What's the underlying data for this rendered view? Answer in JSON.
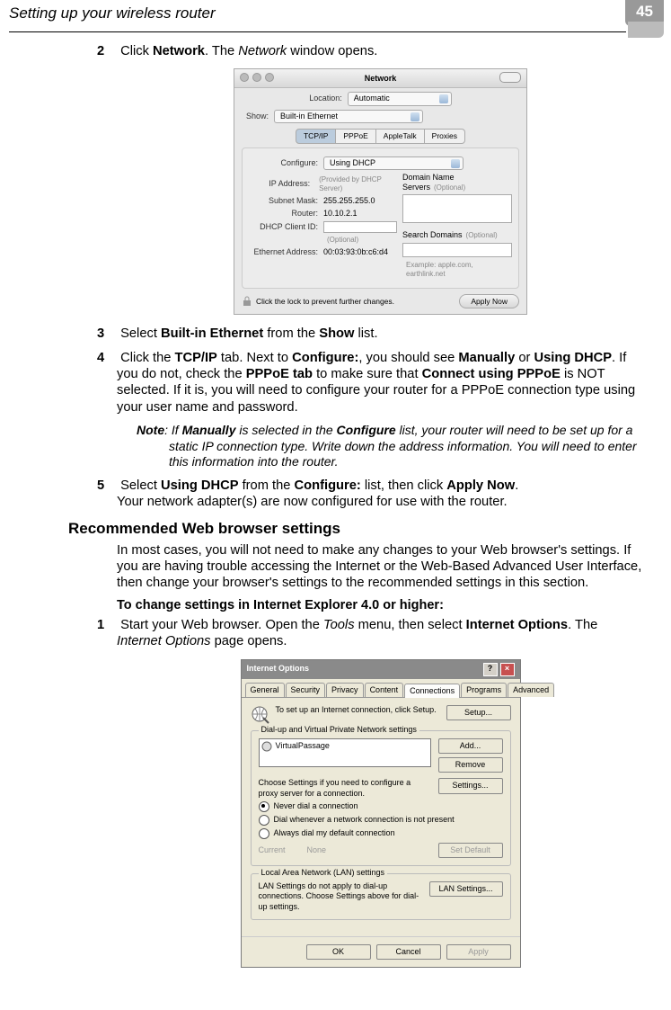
{
  "header": {
    "title": "Setting up your wireless router",
    "page_number": "45"
  },
  "steps": {
    "s2": {
      "num": "2",
      "pre": "Click ",
      "b1": "Network",
      "mid": ". The ",
      "i1": "Network",
      "post": " window opens."
    },
    "s3": {
      "num": "3",
      "pre": "Select ",
      "b1": "Built-in Ethernet",
      "mid": " from the ",
      "b2": "Show",
      "post": " list."
    },
    "s4": {
      "num": "4",
      "a": "Click the ",
      "b1": "TCP/IP",
      "c": " tab. Next to ",
      "b2": "Configure:",
      "d": ", you should see ",
      "b3": "Manually",
      "e": " or ",
      "b4": "Using DHCP",
      "f": ". If you do not, check the ",
      "b5": "PPPoE tab",
      "g": " to make sure that ",
      "b6": "Connect using PPPoE",
      "h": " is NOT selected. If it is, you will need to configure your router for a PPPoE connection type using your user name and password."
    },
    "note": {
      "lead": "Note",
      "a": ": If ",
      "b1": "Manually",
      "b": " is selected in the ",
      "b2": "Configure",
      "c": " list, your router will need to be set up for a static IP connection type. Write down the address information. You will need to enter this information into the router."
    },
    "s5": {
      "num": "5",
      "a": "Select ",
      "b1": "Using DHCP",
      "b": " from the ",
      "b2": "Configure:",
      "c": " list, then click ",
      "b3": "Apply Now",
      "d": ".",
      "line2": "Your network adapter(s) are now configured for use with the router."
    }
  },
  "section2": {
    "heading": "Recommended Web browser settings",
    "para": "In most cases, you will not need to make any changes to your Web browser's settings. If you are having trouble accessing the Internet or the Web-Based Advanced User Interface, then change your browser's settings to the recommended settings in this section.",
    "subhead": "To change settings in Internet Explorer 4.0 or higher:",
    "step1": {
      "num": "1",
      "a": "Start your Web browser. Open the ",
      "i1": "Tools",
      "b": " menu, then select ",
      "b1": "Internet Options",
      "c": ". The ",
      "i2": "Internet Options",
      "d": " page opens."
    }
  },
  "mac": {
    "title": "Network",
    "location_label": "Location:",
    "location_value": "Automatic",
    "show_label": "Show:",
    "show_value": "Built-in Ethernet",
    "tabs": {
      "t1": "TCP/IP",
      "t2": "PPPoE",
      "t3": "AppleTalk",
      "t4": "Proxies"
    },
    "configure_label": "Configure:",
    "configure_value": "Using DHCP",
    "ip_label": "IP Address:",
    "ip_note": "(Provided by DHCP Server)",
    "subnet_label": "Subnet Mask:",
    "subnet_value": "255.255.255.0",
    "router_label": "Router:",
    "router_value": "10.10.2.1",
    "dhcp_label": "DHCP Client ID:",
    "dhcp_note": "(Optional)",
    "eth_label": "Ethernet Address:",
    "eth_value": "00:03:93:0b:c6:d4",
    "dns_label": "Domain Name Servers",
    "optional": "(Optional)",
    "sd_label": "Search Domains",
    "example": "Example: apple.com, earthlink.net",
    "lock_text": "Click the lock to prevent further changes.",
    "apply": "Apply Now"
  },
  "ie": {
    "title": "Internet Options",
    "tabs": {
      "t1": "General",
      "t2": "Security",
      "t3": "Privacy",
      "t4": "Content",
      "t5": "Connections",
      "t6": "Programs",
      "t7": "Advanced"
    },
    "setup_text": "To set up an Internet connection, click Setup.",
    "setup_btn": "Setup...",
    "group1": "Dial-up and Virtual Private Network settings",
    "vp_item": "VirtualPassage",
    "add_btn": "Add...",
    "remove_btn": "Remove",
    "settings_text": "Choose Settings if you need to configure a proxy server for a connection.",
    "settings_btn": "Settings...",
    "r1": "Never dial a connection",
    "r2": "Dial whenever a network connection is not present",
    "r3": "Always dial my default connection",
    "current_label": "Current",
    "current_value": "None",
    "setdefault_btn": "Set Default",
    "group2": "Local Area Network (LAN) settings",
    "lan_text": "LAN Settings do not apply to dial-up connections. Choose Settings above for dial-up settings.",
    "lan_btn": "LAN Settings...",
    "ok": "OK",
    "cancel": "Cancel",
    "apply": "Apply"
  }
}
